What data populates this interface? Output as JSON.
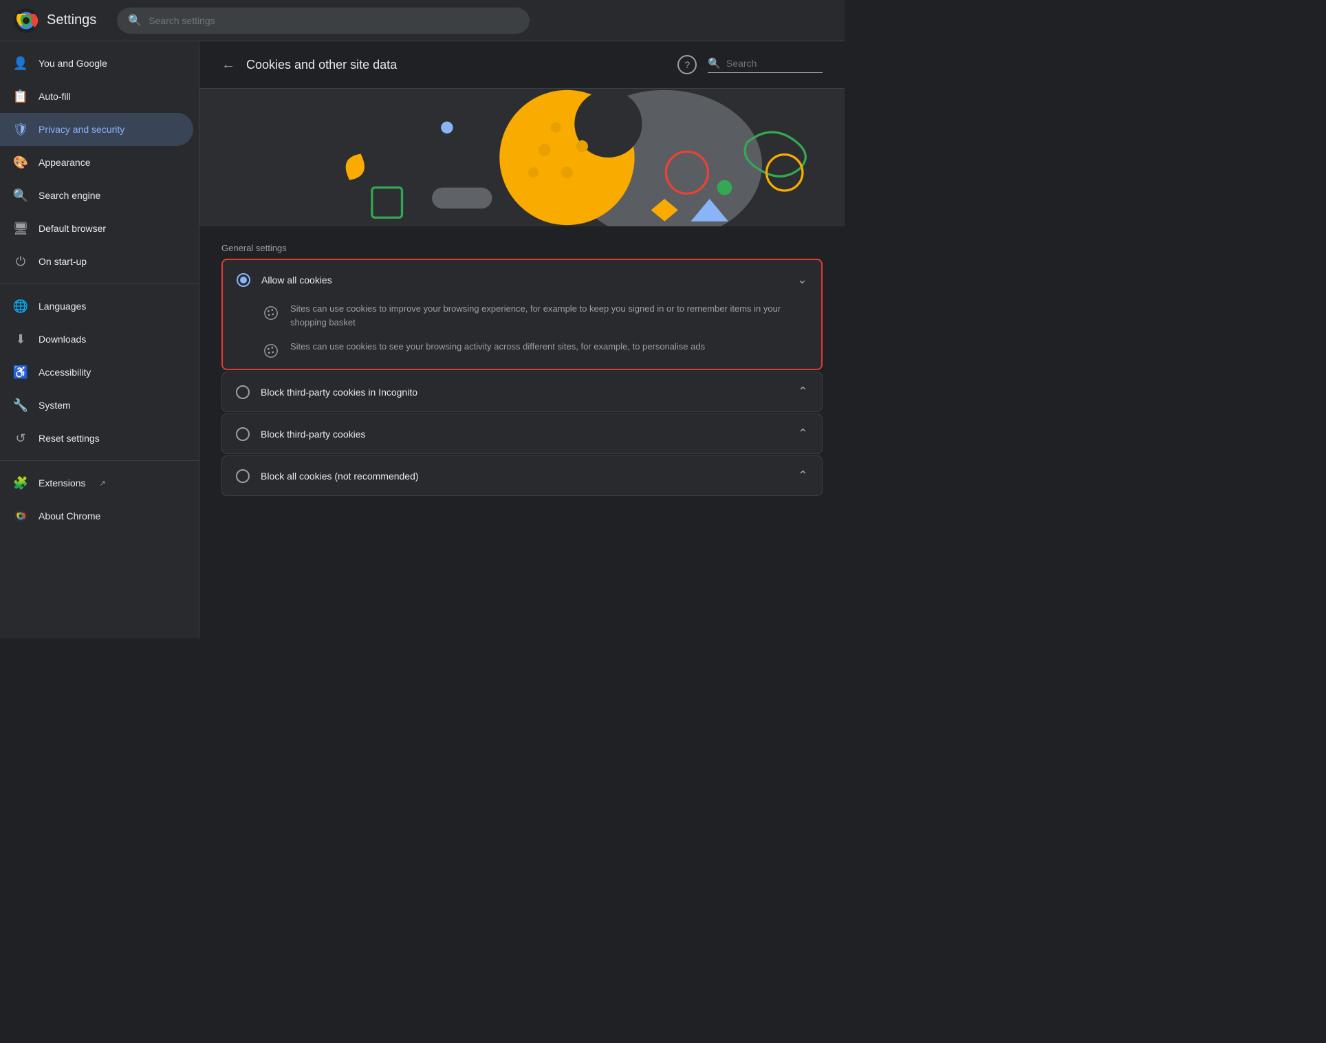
{
  "topbar": {
    "title": "Settings",
    "search_placeholder": "Search settings"
  },
  "sidebar": {
    "items": [
      {
        "id": "you-and-google",
        "label": "You and Google",
        "icon": "person"
      },
      {
        "id": "autofill",
        "label": "Auto-fill",
        "icon": "list"
      },
      {
        "id": "privacy-security",
        "label": "Privacy and security",
        "icon": "shield",
        "active": true
      },
      {
        "id": "appearance",
        "label": "Appearance",
        "icon": "palette"
      },
      {
        "id": "search-engine",
        "label": "Search engine",
        "icon": "search"
      },
      {
        "id": "default-browser",
        "label": "Default browser",
        "icon": "browser"
      },
      {
        "id": "on-startup",
        "label": "On start-up",
        "icon": "power"
      }
    ],
    "items2": [
      {
        "id": "languages",
        "label": "Languages",
        "icon": "globe"
      },
      {
        "id": "downloads",
        "label": "Downloads",
        "icon": "download"
      },
      {
        "id": "accessibility",
        "label": "Accessibility",
        "icon": "accessibility"
      },
      {
        "id": "system",
        "label": "System",
        "icon": "wrench"
      },
      {
        "id": "reset-settings",
        "label": "Reset settings",
        "icon": "history"
      }
    ],
    "items3": [
      {
        "id": "extensions",
        "label": "Extensions",
        "icon": "puzzle",
        "external": true
      },
      {
        "id": "about-chrome",
        "label": "About Chrome",
        "icon": "chrome"
      }
    ]
  },
  "content": {
    "title": "Cookies and other site data",
    "search_placeholder": "Search",
    "section_label": "General settings",
    "options": [
      {
        "id": "allow-all",
        "label": "Allow all cookies",
        "selected": true,
        "expanded": true,
        "sub_items": [
          {
            "text": "Sites can use cookies to improve your browsing experience, for example to keep you signed in or to remember items in your shopping basket"
          },
          {
            "text": "Sites can use cookies to see your browsing activity across different sites, for example, to personalise ads"
          }
        ]
      },
      {
        "id": "block-third-incognito",
        "label": "Block third-party cookies in Incognito",
        "selected": false,
        "expanded": false
      },
      {
        "id": "block-third",
        "label": "Block third-party cookies",
        "selected": false,
        "expanded": false
      },
      {
        "id": "block-all",
        "label": "Block all cookies (not recommended)",
        "selected": false,
        "expanded": false
      }
    ]
  }
}
